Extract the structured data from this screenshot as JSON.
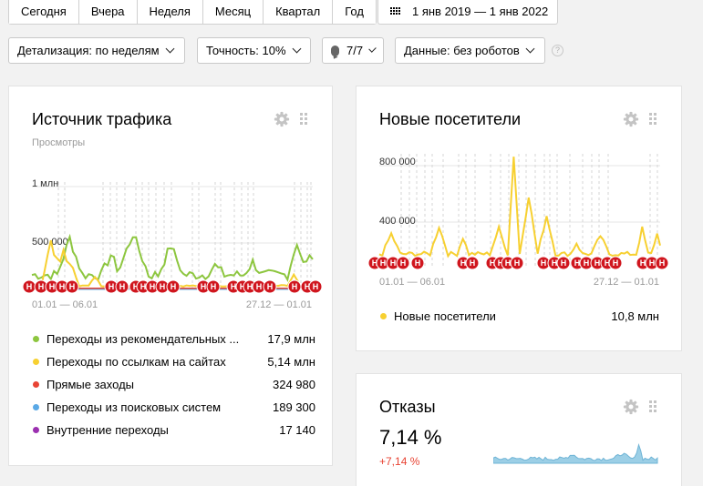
{
  "toolbar": {
    "periods": [
      "Сегодня",
      "Вчера",
      "Неделя",
      "Месяц",
      "Квартал",
      "Год"
    ],
    "daterange": "1 янв 2019 — 1 янв 2022",
    "detail": "Детализация: по неделям",
    "accuracy": "Точность: 10%",
    "comments": "7/7",
    "data_filter": "Данные: без роботов",
    "help": "?"
  },
  "colors": {
    "green": "#8dc63f",
    "yellow": "#f7d031",
    "red": "#e84434",
    "blue": "#5aa9e6",
    "purple": "#9b30b0",
    "marker": "#d0161e",
    "area": "#9ccfe6"
  },
  "icons": [
    "gear-icon",
    "drag-handle-icon",
    "calendar-icon",
    "comment-icon",
    "chevron-down-icon",
    "help-icon"
  ],
  "traffic": {
    "title": "Источник трафика",
    "subtitle": "Просмотры",
    "y_labels": [
      "1 млн",
      "500 000"
    ],
    "x_labels": [
      "01.01 — 06.01",
      "27.12 — 01.01"
    ],
    "marker_letter": "Н",
    "legend": [
      {
        "label": "Переходы из рекомендательных ...",
        "value": "17,9 млн",
        "color": "#8dc63f"
      },
      {
        "label": "Переходы по ссылкам на сайтах",
        "value": "5,14 млн",
        "color": "#f7d031"
      },
      {
        "label": "Прямые заходы",
        "value": "324 980",
        "color": "#e84434"
      },
      {
        "label": "Переходы из поисковых систем",
        "value": "189 300",
        "color": "#5aa9e6"
      },
      {
        "label": "Внутренние переходы",
        "value": "17 140",
        "color": "#9b30b0"
      }
    ]
  },
  "visitors": {
    "title": "Новые посетители",
    "y_labels": [
      "800 000",
      "400 000"
    ],
    "x_labels": [
      "01.01 — 06.01",
      "27.12 — 01.01"
    ],
    "marker_letter": "Н",
    "legend": [
      {
        "label": "Новые посетители",
        "value": "10,8 млн",
        "color": "#f7d031"
      }
    ]
  },
  "bounce": {
    "title": "Отказы",
    "value": "7,14 %",
    "delta": "+7,14 %"
  }
}
